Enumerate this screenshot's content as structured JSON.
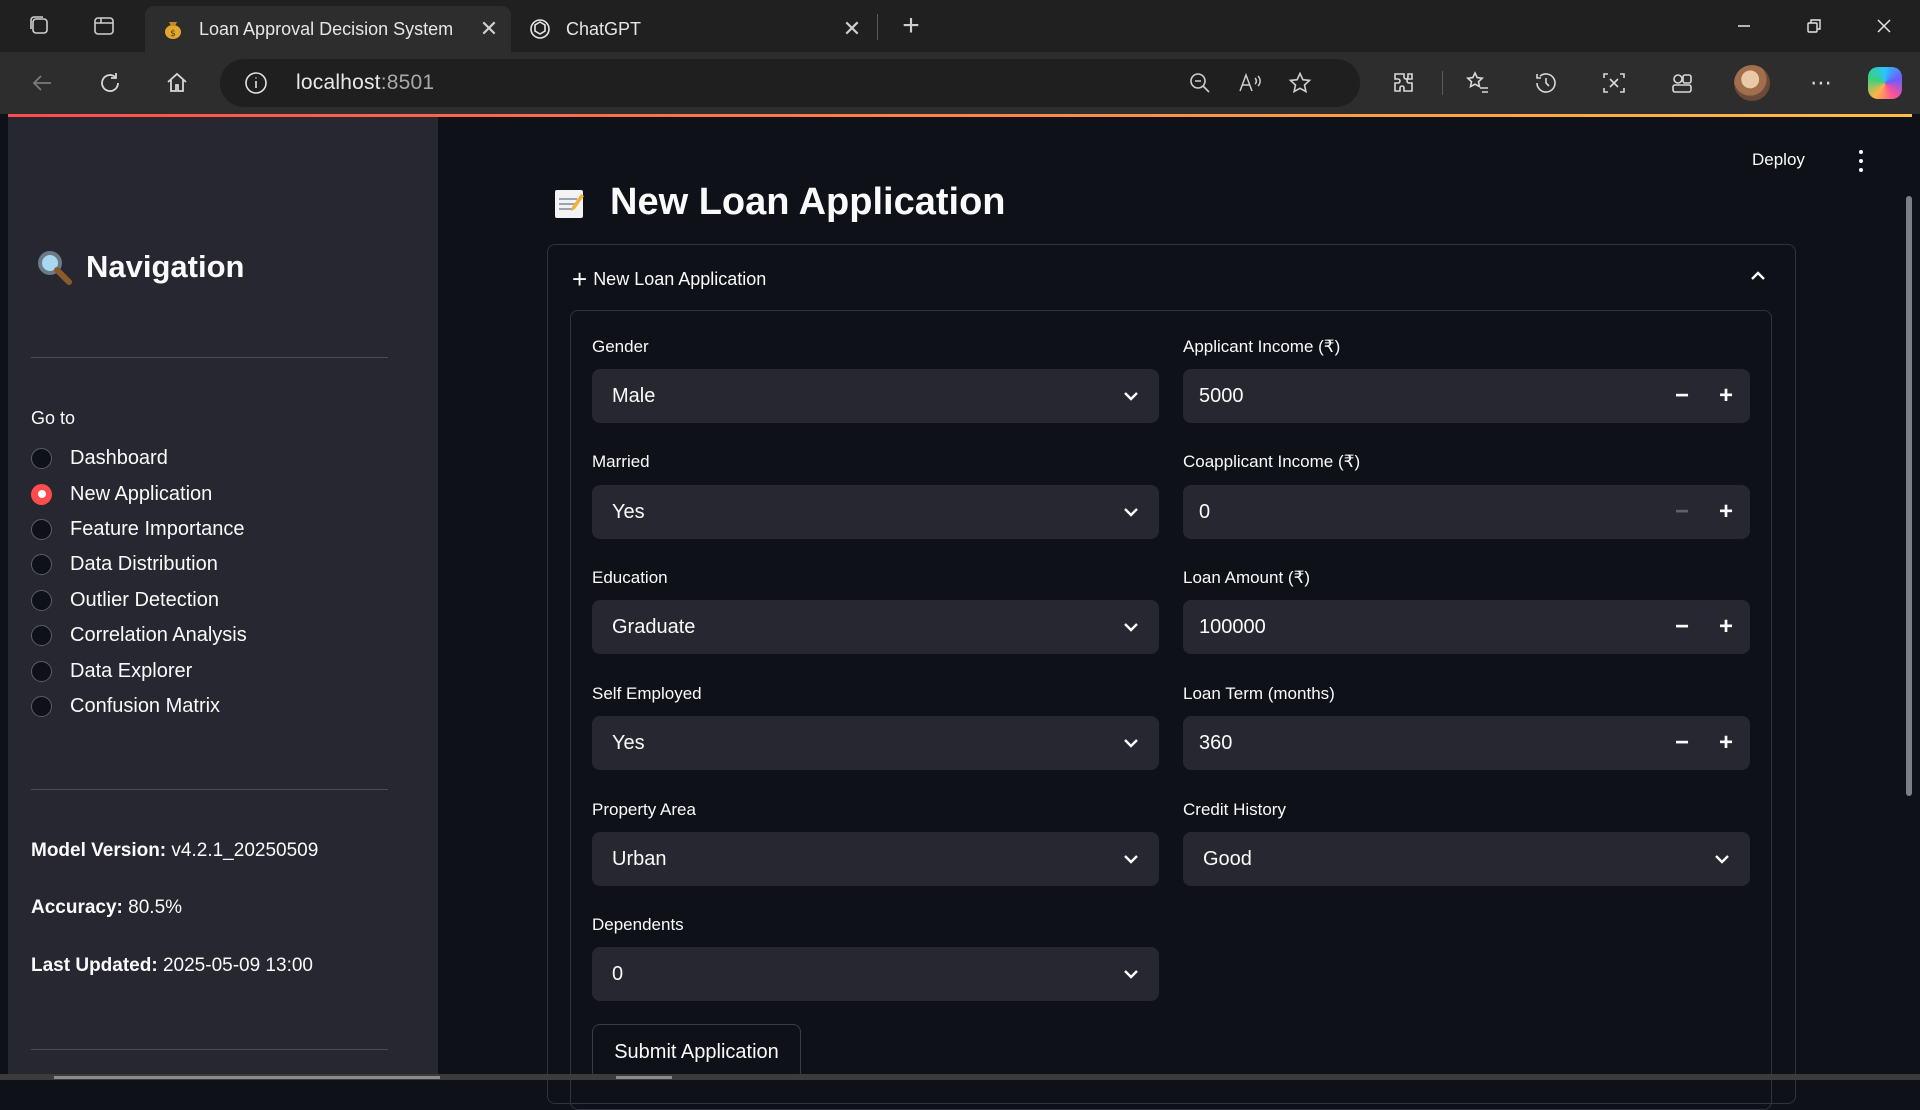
{
  "browser": {
    "tabs": [
      {
        "title": "Loan Approval Decision System",
        "active": true
      },
      {
        "title": "ChatGPT",
        "active": false
      }
    ],
    "address": {
      "host": "localhost",
      "port": ":8501"
    }
  },
  "header": {
    "deploy_label": "Deploy"
  },
  "sidebar": {
    "title": "Navigation",
    "goto_label": "Go to",
    "items": [
      {
        "label": "Dashboard",
        "selected": false
      },
      {
        "label": "New Application",
        "selected": true
      },
      {
        "label": "Feature Importance",
        "selected": false
      },
      {
        "label": "Data Distribution",
        "selected": false
      },
      {
        "label": "Outlier Detection",
        "selected": false
      },
      {
        "label": "Correlation Analysis",
        "selected": false
      },
      {
        "label": "Data Explorer",
        "selected": false
      },
      {
        "label": "Confusion Matrix",
        "selected": false
      }
    ],
    "meta": {
      "model_version_label": "Model Version:",
      "model_version_value": "v4.2.1_20250509",
      "accuracy_label": "Accuracy:",
      "accuracy_value": "80.5%",
      "last_updated_label": "Last Updated:",
      "last_updated_value": "2025-05-09 13:00"
    }
  },
  "main": {
    "page_title": "New Loan Application",
    "expander_label": "New Loan Application",
    "form": {
      "gender": {
        "label": "Gender",
        "value": "Male"
      },
      "married": {
        "label": "Married",
        "value": "Yes"
      },
      "education": {
        "label": "Education",
        "value": "Graduate"
      },
      "self_employed": {
        "label": "Self Employed",
        "value": "Yes"
      },
      "property_area": {
        "label": "Property Area",
        "value": "Urban"
      },
      "dependents": {
        "label": "Dependents",
        "value": "0"
      },
      "applicant_income": {
        "label": "Applicant Income (₹)",
        "value": "5000"
      },
      "coapplicant_income": {
        "label": "Coapplicant Income (₹)",
        "value": "0"
      },
      "loan_amount": {
        "label": "Loan Amount (₹)",
        "value": "100000"
      },
      "loan_term": {
        "label": "Loan Term (months)",
        "value": "360"
      },
      "credit_history": {
        "label": "Credit History",
        "value": "Good"
      },
      "submit_label": "Submit Application"
    }
  },
  "colors": {
    "accent": "#ff4b4b",
    "sidebar_bg": "#262730",
    "main_bg": "#0e1117"
  }
}
